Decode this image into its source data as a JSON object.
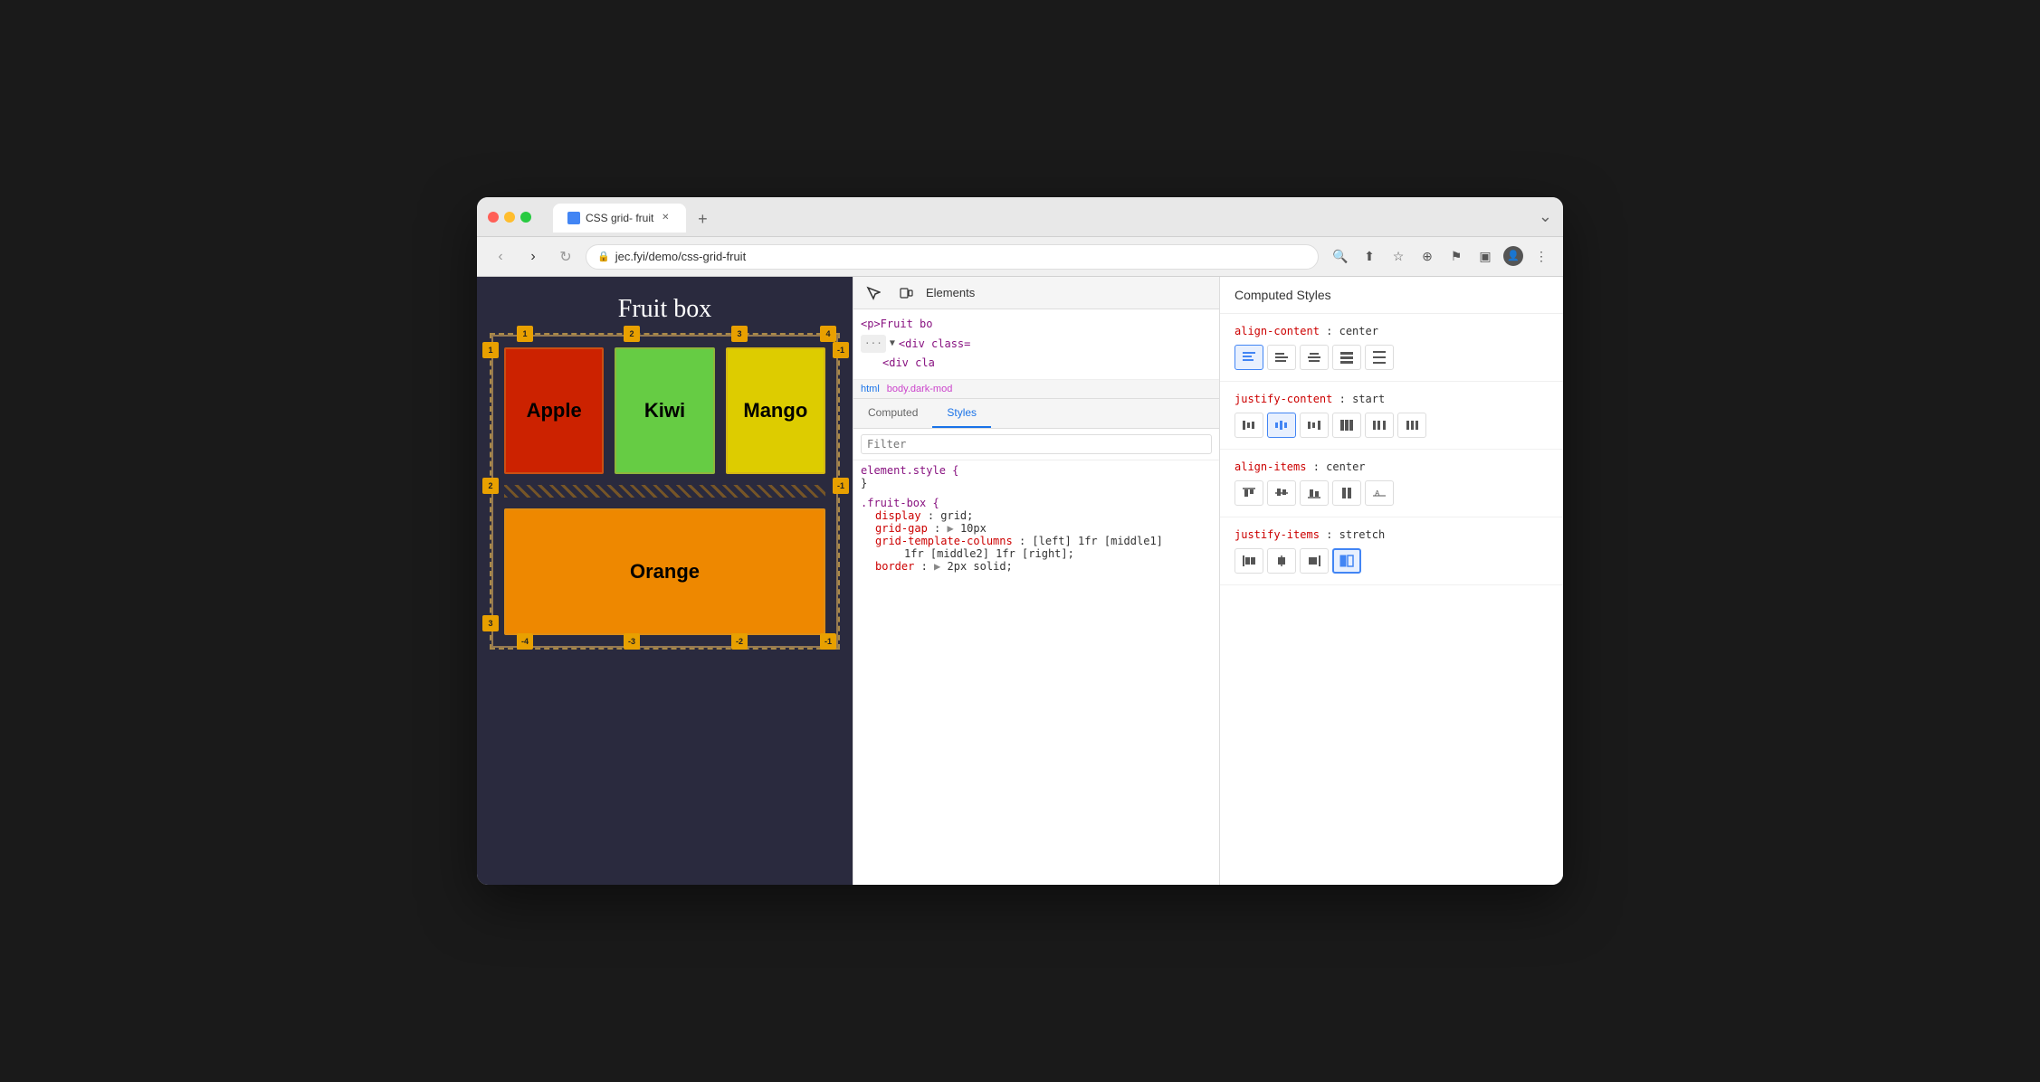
{
  "browser": {
    "tab_title": "CSS grid- fruit",
    "url": "jec.fyi/demo/css-grid-fruit",
    "traffic_lights": [
      "close",
      "minimize",
      "maximize"
    ]
  },
  "webpage": {
    "title": "Fruit box",
    "cells": [
      {
        "name": "Apple",
        "color": "#cc2200"
      },
      {
        "name": "Kiwi",
        "color": "#66cc44"
      },
      {
        "name": "Mango",
        "color": "#ddcc00"
      },
      {
        "name": "Orange",
        "color": "#ee8800"
      }
    ]
  },
  "devtools": {
    "panel_label": "Elements",
    "html_lines": [
      "<p>Fruit bo",
      "<div class=",
      "<div cla"
    ],
    "breadcrumbs": [
      "html",
      "body.dark-mod"
    ],
    "tabs": [
      "Computed",
      "Styles"
    ],
    "active_tab": "Styles",
    "filter_placeholder": "Filter",
    "css_rules": [
      {
        "selector": "element.style {",
        "closing": "}",
        "props": []
      },
      {
        "selector": ".fruit-box {",
        "closing": "",
        "props": [
          {
            "name": "display",
            "value": "grid;"
          },
          {
            "name": "grid-gap",
            "value": "▶ 10px"
          },
          {
            "name": "grid-template-columns",
            "value": "[left] 1fr [middle1]\n    1fr [middle2] 1fr [right];"
          },
          {
            "name": "border",
            "value": "▶ 2px solid;"
          }
        ]
      }
    ]
  },
  "computed_styles": {
    "title": "Computed Styles",
    "sections": [
      {
        "prop": "align-content",
        "value": "center",
        "buttons": [
          {
            "icon": "align-start",
            "label": "start",
            "active": true
          },
          {
            "icon": "align-end",
            "label": "end",
            "active": false
          },
          {
            "icon": "align-center",
            "label": "center",
            "active": false
          },
          {
            "icon": "align-stretch",
            "label": "stretch",
            "active": false
          },
          {
            "icon": "align-between",
            "label": "space-between",
            "active": false
          }
        ]
      },
      {
        "prop": "justify-content",
        "value": "start",
        "buttons": [
          {
            "icon": "jc-start",
            "label": "start",
            "active": false
          },
          {
            "icon": "jc-center",
            "label": "center",
            "active": true
          },
          {
            "icon": "jc-end",
            "label": "end",
            "active": false
          },
          {
            "icon": "jc-stretch",
            "label": "stretch",
            "active": false
          },
          {
            "icon": "jc-between",
            "label": "space-between",
            "active": false
          },
          {
            "icon": "jc-around",
            "label": "space-around",
            "active": false
          }
        ]
      },
      {
        "prop": "align-items",
        "value": "center",
        "buttons": [
          {
            "icon": "ai-start",
            "label": "start",
            "active": false
          },
          {
            "icon": "ai-center",
            "label": "center",
            "active": false
          },
          {
            "icon": "ai-end",
            "label": "end",
            "active": false
          },
          {
            "icon": "ai-stretch",
            "label": "stretch",
            "active": false
          },
          {
            "icon": "ai-baseline",
            "label": "baseline",
            "active": false
          }
        ]
      },
      {
        "prop": "justify-items",
        "value": "stretch",
        "buttons": [
          {
            "icon": "ji-start",
            "label": "start",
            "active": false
          },
          {
            "icon": "ji-center",
            "label": "center",
            "active": false
          },
          {
            "icon": "ji-end",
            "label": "end",
            "active": false
          },
          {
            "icon": "ji-stretch",
            "label": "stretch",
            "active": true
          }
        ]
      }
    ]
  }
}
